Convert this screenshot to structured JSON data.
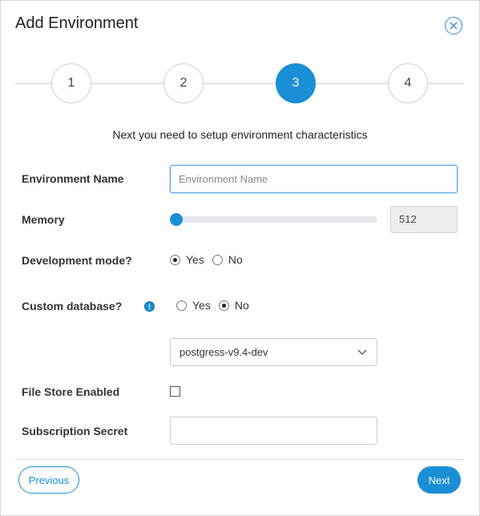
{
  "dialog": {
    "title": "Add Environment"
  },
  "stepper": {
    "steps": [
      {
        "label": "1",
        "active": false
      },
      {
        "label": "2",
        "active": false
      },
      {
        "label": "3",
        "active": true
      },
      {
        "label": "4",
        "active": false
      }
    ]
  },
  "subtitle": "Next you need to setup environment characteristics",
  "form": {
    "environment_name": {
      "label": "Environment Name",
      "value": "",
      "placeholder": "Environment Name"
    },
    "memory": {
      "label": "Memory",
      "value": "512",
      "slider_fraction": 0.0
    },
    "development_mode": {
      "label": "Development mode?",
      "options": [
        {
          "label": "Yes",
          "checked": true
        },
        {
          "label": "No",
          "checked": false
        }
      ]
    },
    "custom_database": {
      "label": "Custom database?",
      "info_icon": "info-icon",
      "options": [
        {
          "label": "Yes",
          "checked": false
        },
        {
          "label": "No",
          "checked": true
        }
      ]
    },
    "database_select": {
      "selected": "postgress-v9.4-dev"
    },
    "file_store": {
      "label": "File Store Enabled",
      "checked": false
    },
    "subscription_secret": {
      "label": "Subscription Secret",
      "value": ""
    }
  },
  "footer": {
    "previous_label": "Previous",
    "next_label": "Next"
  },
  "colors": {
    "accent": "#1a8fd6",
    "border": "#cccccc",
    "readonly_bg": "#eeeeee"
  }
}
